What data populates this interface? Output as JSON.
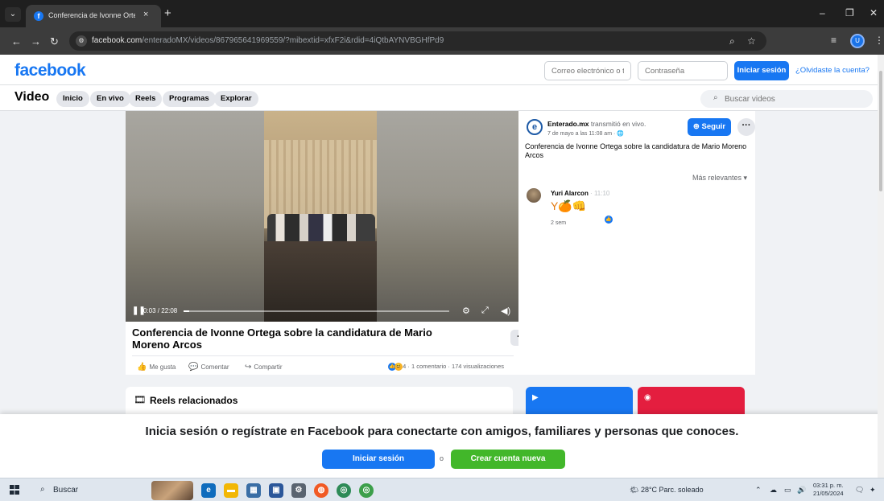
{
  "browser": {
    "tab_title": "Conferencia de Ivonne Ortega",
    "tab_close": "×",
    "new_tab": "+",
    "url_domain": "facebook.com",
    "url_path": "/enteradoMX/videos/867965641969559/?mibextid=xfxF2i&rdid=4iQtbAYNVBGHfPd9",
    "profile_initial": "U",
    "win_min": "–",
    "win_max": "❐",
    "win_close": "✕"
  },
  "fb_header": {
    "logo": "facebook",
    "email_placeholder": "Correo electrónico o tel",
    "password_placeholder": "Contraseña",
    "login_label": "Iniciar sesión",
    "forgot_label": "¿Olvidaste la cuenta?"
  },
  "video_nav": {
    "title": "Video",
    "tabs": [
      "Inicio",
      "En vivo",
      "Reels",
      "Programas",
      "Explorar"
    ],
    "search_placeholder": "Buscar videos"
  },
  "player": {
    "time": "0:03 / 22:08",
    "progress_fraction": 0.01,
    "play_icon": "pause-icon"
  },
  "video_info": {
    "title": "Conferencia de Ivonne Ortega sobre la candidatura de Mario Moreno Arcos",
    "more": "···",
    "like": "Me gusta",
    "comment": "Comentar",
    "share": "Compartir",
    "reaction_count": "4",
    "stats": "· 1 comentario · 174 visualizaciones"
  },
  "panel": {
    "page_name": "Enterado.mx",
    "page_action": " transmitió en vivo.",
    "date": "7 de mayo a las 11:08 am · ",
    "follow_label": "Seguir",
    "more": "···",
    "description": "Conferencia de Ivonne Ortega sobre la candidatura de Mario Moreno Arcos",
    "sort_label": "Más relevantes ▾",
    "comment": {
      "author": "Yuri Alarcon",
      "time_mark": " · 11:10",
      "text": "Y🍊👊",
      "age": "2 sem"
    }
  },
  "lower": {
    "reels_title": "Reels relacionados"
  },
  "prompt": {
    "text": "Inicia sesión o regístrate en Facebook para conectarte con amigos, familiares y personas que conoces.",
    "login_label": "Iniciar sesión",
    "or": "o",
    "create_label": "Crear cuenta nueva"
  },
  "taskbar": {
    "search": "Buscar",
    "weather": "28°C  Parc. soleado",
    "time": "03:31 p. m.",
    "date": "21/05/2024"
  },
  "colors": {
    "fb_blue": "#1877f2",
    "green": "#42b72a",
    "red": "#e41e3f"
  }
}
